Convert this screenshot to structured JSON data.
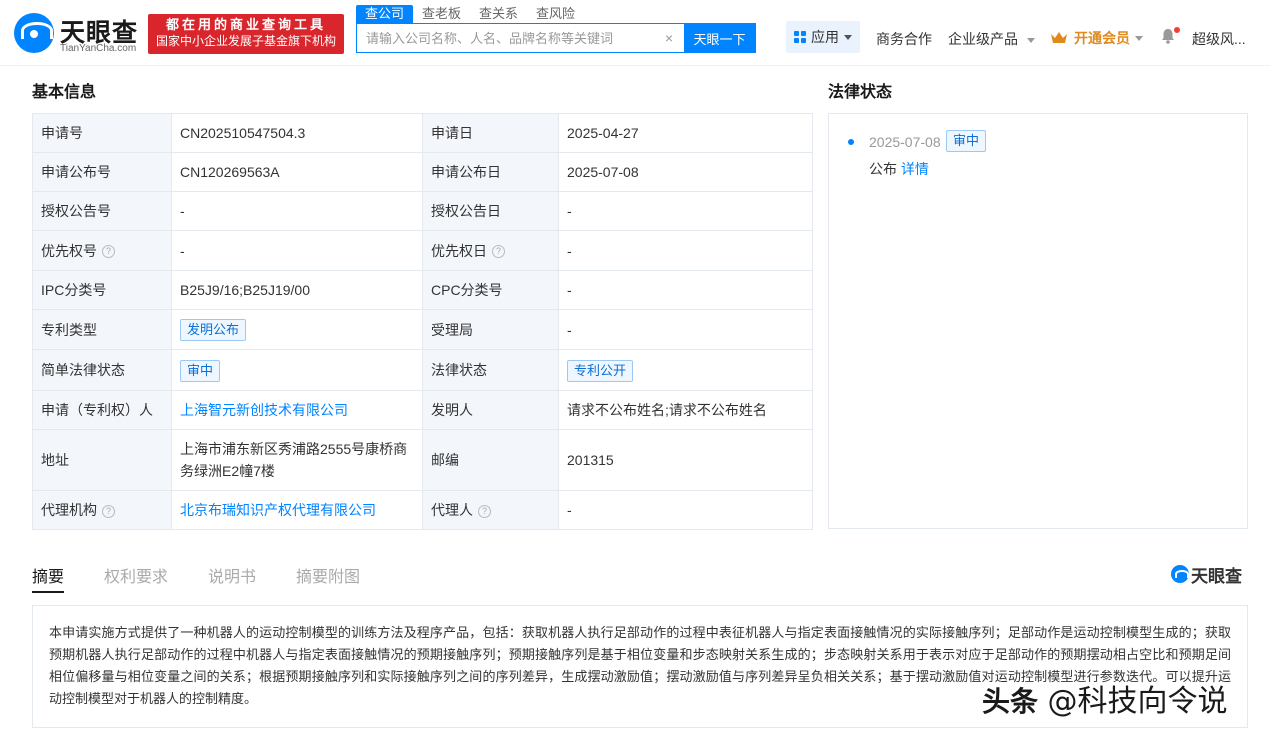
{
  "header": {
    "logo_name": "天眼查",
    "logo_domain": "TianYanCha.com",
    "slogan_line1": "都在用的商业查询工具",
    "slogan_line2": "国家中小企业发展子基金旗下机构",
    "search_tabs": [
      "查公司",
      "查老板",
      "查关系",
      "查风险"
    ],
    "search_placeholder": "请输入公司名称、人名、品牌名称等关键词",
    "search_button": "天眼一下",
    "nav_app": "应用",
    "nav_business": "商务合作",
    "nav_enterprise": "企业级产品",
    "nav_vip": "开通会员",
    "nav_user": "超级风..."
  },
  "basic_info": {
    "title": "基本信息",
    "rows": [
      {
        "k1": "申请号",
        "v1": "CN202510547504.3",
        "k2": "申请日",
        "v2": "2025-04-27"
      },
      {
        "k1": "申请公布号",
        "v1": "CN120269563A",
        "k2": "申请公布日",
        "v2": "2025-07-08"
      },
      {
        "k1": "授权公告号",
        "v1": "-",
        "k2": "授权公告日",
        "v2": "-"
      },
      {
        "k1": "优先权号",
        "v1": "-",
        "k2": "优先权日",
        "v2": "-"
      },
      {
        "k1": "IPC分类号",
        "v1": "B25J9/16;B25J19/00",
        "k2": "CPC分类号",
        "v2": "-"
      },
      {
        "k1": "专利类型",
        "v1": "发明公布",
        "k2": "受理局",
        "v2": "-"
      },
      {
        "k1": "简单法律状态",
        "v1": "审中",
        "k2": "法律状态",
        "v2": "专利公开"
      },
      {
        "k1": "申请（专利权）人",
        "v1": "上海智元新创技术有限公司",
        "k2": "发明人",
        "v2": "请求不公布姓名;请求不公布姓名"
      },
      {
        "k1": "地址",
        "v1": "上海市浦东新区秀浦路2555号康桥商务绿洲E2幢7楼",
        "k2": "邮编",
        "v2": "201315"
      },
      {
        "k1": "代理机构",
        "v1": "北京布瑞知识产权代理有限公司",
        "k2": "代理人",
        "v2": "-"
      }
    ]
  },
  "legal": {
    "title": "法律状态",
    "date": "2025-07-08",
    "status": "审中",
    "event": "公布",
    "detail_link": "详情"
  },
  "tabs": [
    "摘要",
    "权利要求",
    "说明书",
    "摘要附图"
  ],
  "brand_small": "天眼查",
  "abstract": "本申请实施方式提供了一种机器人的运动控制模型的训练方法及程序产品，包括：获取机器人执行足部动作的过程中表征机器人与指定表面接触情况的实际接触序列；足部动作是运动控制模型生成的；获取预期机器人执行足部动作的过程中机器人与指定表面接触情况的预期接触序列；预期接触序列是基于相位变量和步态映射关系生成的；步态映射关系用于表示对应于足部动作的预期摆动相占空比和预期足间相位偏移量与相位变量之间的关系；根据预期接触序列和实际接触序列之间的序列差异，生成摆动激励值；摆动激励值与序列差异呈负相关关系；基于摆动激励值对运动控制模型进行参数迭代。可以提升运动控制模型对于机器人的控制精度。",
  "watermark": {
    "part1": "头条",
    "part2": " @科技向令说"
  },
  "colors": {
    "accent": "#0084ff",
    "slogan_bg": "#d9262c",
    "vip": "#e08a1e",
    "key_cell_bg": "#f3f6fb"
  }
}
